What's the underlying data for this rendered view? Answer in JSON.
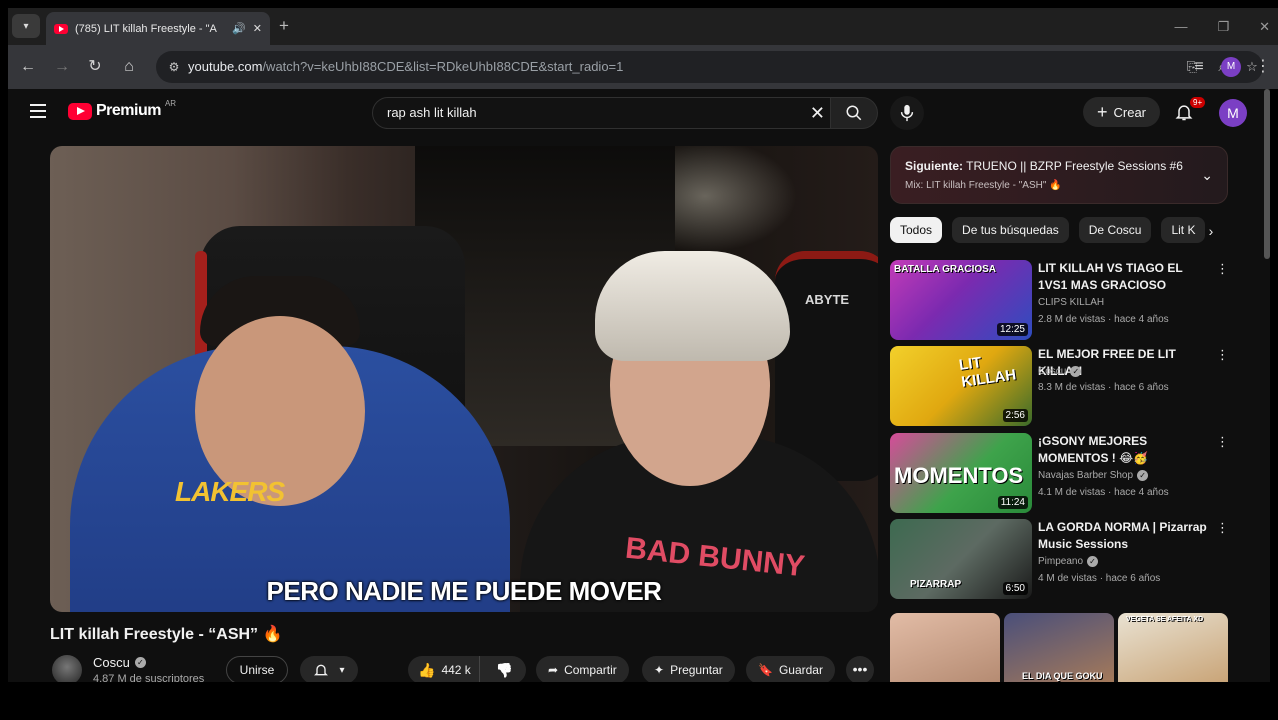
{
  "browser": {
    "tab_title": "(785) LIT killah Freestyle - \"A",
    "url_host": "youtube.com",
    "url_path": "/watch?v=keUhbI88CDE&list=RDkeUhbI88CDE&start_radio=1",
    "profile_letter": "M"
  },
  "header": {
    "logo_text": "Premium",
    "country_code": "AR",
    "search_value": "rap ash lit killah",
    "create_label": "Crear",
    "notification_badge": "9+",
    "avatar_letter": "M"
  },
  "video": {
    "caption": "PERO NADIE ME PUEDE MOVER",
    "title": "LIT killah Freestyle - “ASH” 🔥",
    "overlay_byte": "ABYTE",
    "overlay_lakers": "LAKERS",
    "overlay_badbunny": "BAD BUNNY"
  },
  "channel": {
    "name": "Coscu",
    "subscribers": "4.87 M de suscriptores",
    "join_label": "Unirse"
  },
  "actions": {
    "likes": "442 k",
    "share_label": "Compartir",
    "ask_label": "Preguntar",
    "save_label": "Guardar"
  },
  "up_next": {
    "prefix": "Siguiente:",
    "title": "TRUENO || BZRP Freestyle Sessions #6",
    "mix": "Mix: LIT killah Freestyle - \"ASH\" 🔥"
  },
  "chips": [
    "Todos",
    "De tus búsquedas",
    "De Coscu",
    "Lit K"
  ],
  "recommendations": [
    {
      "title": "LIT KILLAH VS TIAGO EL 1VS1 MAS GRACIOSO",
      "channel": "CLIPS KILLAH",
      "verified": false,
      "meta": "2.8 M de vistas · hace 4 años",
      "duration": "12:25",
      "thumb_text": "BATALLA GRACIOSA"
    },
    {
      "title": "EL MEJOR FREE DE LIT KILLAH",
      "channel": "Coscu",
      "verified": true,
      "meta": "8.3 M de vistas · hace 6 años",
      "duration": "2:56",
      "thumb_text": "LIT KILLAH"
    },
    {
      "title": "¡GSONY MEJORES MOMENTOS ! 😂🥳 PARODIA...",
      "channel": "Navajas Barber Shop",
      "verified": true,
      "meta": "4.1 M de vistas · hace 4 años",
      "duration": "11:24",
      "thumb_text": "MOMENTOS"
    },
    {
      "title": "LA GORDA NORMA | Pizarrap Music Sessions",
      "channel": "Pimpeano",
      "verified": true,
      "meta": "4 M de vistas · hace 6 años",
      "duration": "6:50",
      "thumb_text": "PIZARRAP"
    }
  ],
  "shorts": [
    "",
    "EL DIA QUE GOKU",
    "VEGETA SE AFEITA XD"
  ],
  "colors": {
    "brand_red": "#ff0033",
    "background": "#0f0f0f",
    "chrome_tab": "#35363a",
    "avatar_purple": "#7b3fc4"
  }
}
